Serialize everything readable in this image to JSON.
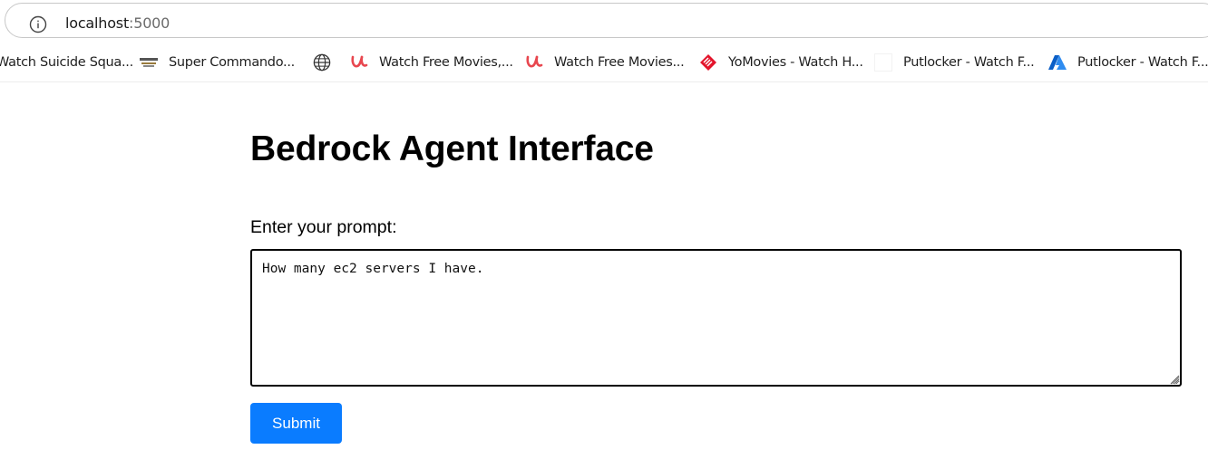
{
  "browser": {
    "url_host": "localhost",
    "url_port": ":5000"
  },
  "bookmarks": [
    {
      "label": "Watch Suicide Squa...",
      "icon": "none"
    },
    {
      "label": "Super Commando...",
      "icon": "site-logo-icon"
    },
    {
      "label": "",
      "icon": "globe-icon"
    },
    {
      "label": "Watch Free Movies,...",
      "icon": "u-brand-icon",
      "color": "#e8474f"
    },
    {
      "label": "Watch Free Movies...",
      "icon": "u-brand-icon",
      "color": "#e8474f"
    },
    {
      "label": "YoMovies - Watch H...",
      "icon": "yomovies-icon",
      "color": "#e3142b"
    },
    {
      "label": "Putlocker - Watch F...",
      "icon": "blank-icon"
    },
    {
      "label": "Putlocker - Watch F...",
      "icon": "azure-a-icon",
      "color": "#1a73e8"
    }
  ],
  "page": {
    "title": "Bedrock Agent Interface",
    "prompt_label": "Enter your prompt:",
    "prompt_value": "How many ec2 servers I have.",
    "submit_label": "Submit"
  },
  "colors": {
    "submit_bg": "#0a7cff",
    "brand_red": "#e8474f",
    "azure_blue": "#1a73e8"
  }
}
